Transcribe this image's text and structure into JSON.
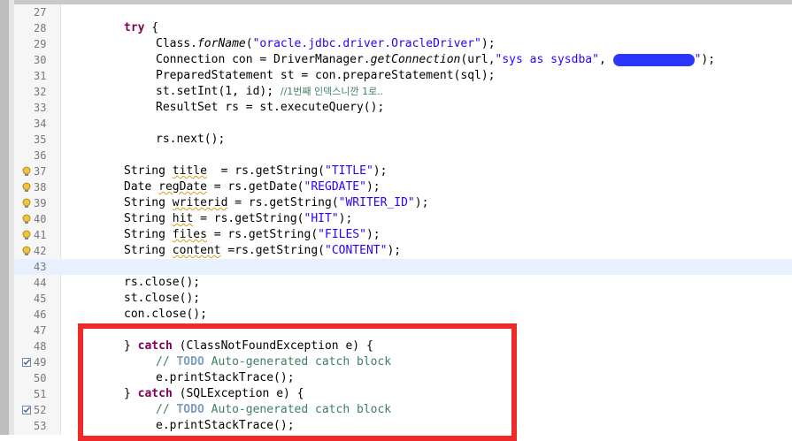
{
  "editor": {
    "lines": [
      {
        "n": "27"
      },
      {
        "n": "28"
      },
      {
        "n": "29"
      },
      {
        "n": "30"
      },
      {
        "n": "31"
      },
      {
        "n": "32"
      },
      {
        "n": "33"
      },
      {
        "n": "34"
      },
      {
        "n": "35"
      },
      {
        "n": "36"
      },
      {
        "n": "37",
        "marker": "warning-lightbulb-icon"
      },
      {
        "n": "38",
        "marker": "warning-lightbulb-icon"
      },
      {
        "n": "39",
        "marker": "warning-lightbulb-icon"
      },
      {
        "n": "40",
        "marker": "warning-lightbulb-icon"
      },
      {
        "n": "41",
        "marker": "warning-lightbulb-icon"
      },
      {
        "n": "42",
        "marker": "warning-lightbulb-icon"
      },
      {
        "n": "43"
      },
      {
        "n": "44"
      },
      {
        "n": "45"
      },
      {
        "n": "46"
      },
      {
        "n": "47"
      },
      {
        "n": "48"
      },
      {
        "n": "49",
        "marker": "task-icon"
      },
      {
        "n": "50"
      },
      {
        "n": "51"
      },
      {
        "n": "52",
        "marker": "task-icon"
      },
      {
        "n": "53"
      }
    ],
    "code": {
      "l28_kw": "try",
      "l28_rest": " {",
      "l29_a": "Class.",
      "l29_m": "forName",
      "l29_b": "(",
      "l29_s": "\"oracle.jdbc.driver.OracleDriver\"",
      "l29_c": ");",
      "l30_a": "Connection con = DriverManager.",
      "l30_m": "getConnection",
      "l30_b": "(url,",
      "l30_s": "\"sys as sysdba\"",
      "l30_c": ", ",
      "l30_s2": "\"",
      "l30_d": ");",
      "l31": "PreparedStatement st = con.prepareStatement(sql);",
      "l32_a": "st.setInt(1, id); ",
      "l32_c": "//1번째 인덱스니깐 1로..",
      "l33": "ResultSet rs = st.executeQuery();",
      "l35": "rs.next();",
      "l37_a": "String ",
      "l37_v": "title",
      "l37_b": "  = rs.getString(",
      "l37_s": "\"TITLE\"",
      "l37_c": ");",
      "l38_a": "Date ",
      "l38_v": "regDate",
      "l38_b": " = rs.getDate(",
      "l38_s": "\"REGDATE\"",
      "l38_c": ");",
      "l39_a": "String ",
      "l39_v": "writerid",
      "l39_b": " = rs.getString(",
      "l39_s": "\"WRITER_ID\"",
      "l39_c": ");",
      "l40_a": "String ",
      "l40_v": "hit",
      "l40_b": " = rs.getString(",
      "l40_s": "\"HIT\"",
      "l40_c": ");",
      "l41_a": "String ",
      "l41_v": "files",
      "l41_b": " = rs.getString(",
      "l41_s": "\"FILES\"",
      "l41_c": ");",
      "l42_a": "String ",
      "l42_v": "content",
      "l42_b": " =rs.getString(",
      "l42_s": "\"CONTENT\"",
      "l42_c": ");",
      "l44": "rs.close();",
      "l45": "st.close();",
      "l46": "con.close();",
      "l48_a": "} ",
      "l48_kw": "catch",
      "l48_b": " (ClassNotFoundException e) {",
      "l49_c1": "// ",
      "l49_todo": "TODO",
      "l49_c2": " Auto-generated catch block",
      "l50": "e.printStackTrace();",
      "l51_a": "} ",
      "l51_kw": "catch",
      "l51_b": " (SQLException e) {",
      "l52_c1": "// ",
      "l52_todo": "TODO",
      "l52_c2": " Auto-generated catch block",
      "l53": "e.printStackTrace();"
    }
  },
  "colors": {
    "keyword": "#7f0055",
    "string": "#2a00ff",
    "comment": "#3f7f5f",
    "todo": "#7f9fbf",
    "highlight_border": "#ee2a2a",
    "redaction": "#2a35ff",
    "current_line": "#e8f2fe"
  }
}
